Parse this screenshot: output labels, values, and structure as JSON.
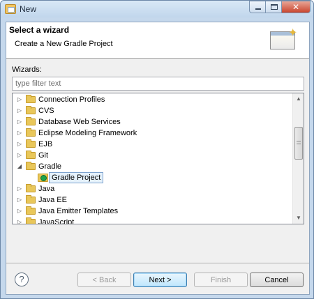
{
  "window": {
    "title": "New"
  },
  "header": {
    "title": "Select a wizard",
    "description": "Create a New Gradle Project"
  },
  "wizards": {
    "label": "Wizards:",
    "filter_placeholder": "type filter text",
    "filter_value": ""
  },
  "tree": {
    "items": [
      {
        "label": "Connection Profiles",
        "expanded": false
      },
      {
        "label": "CVS",
        "expanded": false
      },
      {
        "label": "Database Web Services",
        "expanded": false
      },
      {
        "label": "Eclipse Modeling Framework",
        "expanded": false
      },
      {
        "label": "EJB",
        "expanded": false
      },
      {
        "label": "Git",
        "expanded": false
      },
      {
        "label": "Gradle",
        "expanded": true
      },
      {
        "label": "Gradle Project",
        "child": true,
        "selected": true
      },
      {
        "label": "Java",
        "expanded": false
      },
      {
        "label": "Java EE",
        "expanded": false
      },
      {
        "label": "Java Emitter Templates",
        "expanded": false
      },
      {
        "label": "JavaScript",
        "expanded": false
      }
    ]
  },
  "buttons": {
    "help": "?",
    "back": "< Back",
    "next": "Next >",
    "finish": "Finish",
    "cancel": "Cancel"
  }
}
